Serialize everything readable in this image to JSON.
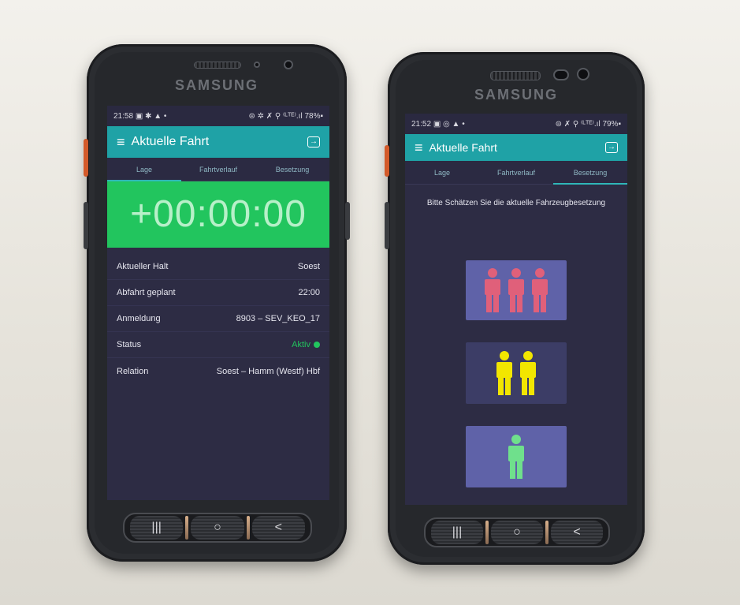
{
  "left_phone": {
    "brand": "SAMSUNG",
    "status_time": "21:58",
    "status_icons": "▣ ✱ ▲ •",
    "status_right": "⊜ ✲ ✗ ⚲ ⁽ᴸᵀᴱ⁾.ıl 78%▪",
    "app_title": "Aktuelle Fahrt",
    "tabs": [
      "Lage",
      "Fahrtverlauf",
      "Besetzung"
    ],
    "timer": "+00:00:00",
    "rows": [
      {
        "label": "Aktueller Halt",
        "value": "Soest"
      },
      {
        "label": "Abfahrt geplant",
        "value": "22:00"
      },
      {
        "label": "Anmeldung",
        "value": "8903 – SEV_KEO_17"
      },
      {
        "label": "Status",
        "value": "Aktiv"
      },
      {
        "label": "Relation",
        "value": "Soest – Hamm (Westf) Hbf"
      }
    ]
  },
  "right_phone": {
    "brand": "SAMSUNG",
    "status_time": "21:52",
    "status_icons": "▣ ◎ ▲ •",
    "status_right": "⊜ ✗ ⚲ ⁽ᴸᵀᴱ⁾.ıl 79%▪",
    "app_title": "Aktuelle Fahrt",
    "tabs": [
      "Lage",
      "Fahrtverlauf",
      "Besetzung"
    ],
    "prompt": "Bitte Schätzen Sie die aktuelle Fahrzeugbesetzung",
    "occupancy_levels": [
      {
        "persons": 3,
        "color": "#e0607a",
        "bg": "#5f62a8"
      },
      {
        "persons": 2,
        "color": "#f2e600",
        "bg": "#3c3d66"
      },
      {
        "persons": 1,
        "color": "#6fe08c",
        "bg": "#5f62a8"
      }
    ]
  },
  "colors": {
    "appbar": "#1fa2a6",
    "timer_bg": "#22c55e",
    "screen_bg": "#2d2c44"
  },
  "nav_keys": [
    "recents-icon",
    "home-icon",
    "back-icon"
  ]
}
